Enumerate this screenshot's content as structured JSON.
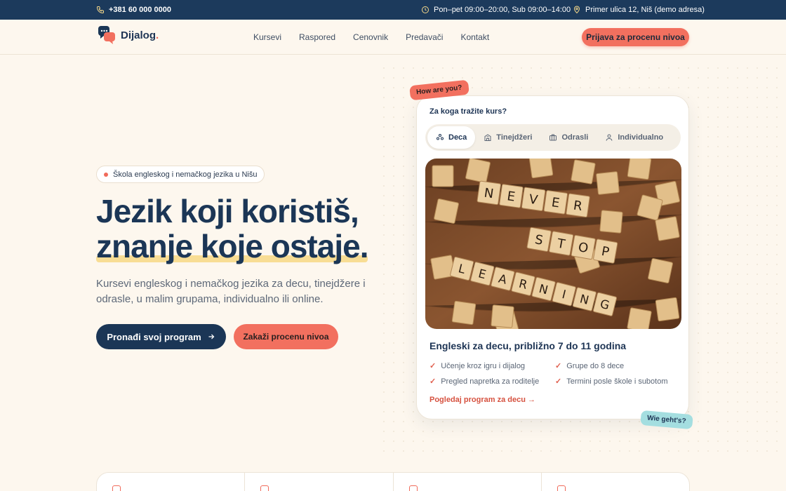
{
  "topbar": {
    "phone": "+381 60 000 0000",
    "hours": "Pon–pet 09:00–20:00, Sub 09:00–14:00",
    "address": "Primer ulica 12, Niš (demo adresa)"
  },
  "nav": {
    "brand": "Dijalog",
    "brand_dot": ".",
    "items": [
      "Kursevi",
      "Raspored",
      "Cenovnik",
      "Predavači",
      "Kontakt"
    ],
    "cta": "Prijava za procenu nivoa"
  },
  "hero": {
    "badge": "Škola engleskog i nemačkog jezika u Nišu",
    "headline_1": "Jezik koji koristiš,",
    "headline_2": "znanje koje ostaje.",
    "subtitle": "Kursevi engleskog i nemačkog jezika za decu, tinejdžere i odrasle, u malim grupama, individualno ili online.",
    "primary_button": "Pronađi svoj program",
    "secondary_button": "Zakaži procenu nivoa"
  },
  "card": {
    "question": "Za koga tražite kurs?",
    "tabs": [
      {
        "label": "Deca",
        "icon": "kids-icon",
        "active": true
      },
      {
        "label": "Tinejdžeri",
        "icon": "school-icon",
        "active": false
      },
      {
        "label": "Odrasli",
        "icon": "briefcase-icon",
        "active": false
      },
      {
        "label": "Individualno",
        "icon": "person-icon",
        "active": false
      }
    ],
    "photo_tiles": {
      "row1": [
        "N",
        "E",
        "V",
        "E",
        "R"
      ],
      "row2": [
        "S",
        "T",
        "O",
        "P"
      ],
      "row3": [
        "L",
        "E",
        "A",
        "R",
        "N",
        "I",
        "N",
        "G"
      ]
    },
    "title": "Engleski za decu, približno 7 do 11 godina",
    "features": [
      "Učenje kroz igru i dijalog",
      "Grupe do 8 dece",
      "Pregled napretka za roditelje",
      "Termini posle škole i subotom"
    ],
    "link": "Pogledaj program za decu"
  },
  "stickers": {
    "english": "How are you?",
    "german": "Wie geht's?"
  },
  "colors": {
    "navy": "#1b3656",
    "coral": "#f2705f",
    "cream": "#fdf7ee",
    "mint": "#a4dee0",
    "highlight": "#f7d98a"
  }
}
